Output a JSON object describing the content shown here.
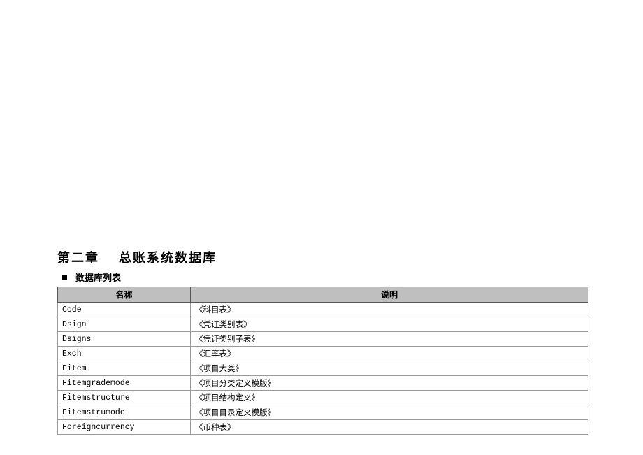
{
  "chapter": {
    "number": "第二章",
    "title": "总账系统数据库"
  },
  "subheading": "数据库列表",
  "table": {
    "headers": {
      "name": "名称",
      "desc": "说明"
    },
    "rows": [
      {
        "name": "Code",
        "desc": "《科目表》"
      },
      {
        "name": "Dsign",
        "desc": "《凭证类别表》"
      },
      {
        "name": "Dsigns",
        "desc": "《凭证类别子表》"
      },
      {
        "name": "Exch",
        "desc": "《汇率表》"
      },
      {
        "name": "Fitem",
        "desc": "《项目大类》"
      },
      {
        "name": "Fitemgrademode",
        "desc": "《项目分类定义模版》"
      },
      {
        "name": "Fitemstructure",
        "desc": "《项目结构定义》"
      },
      {
        "name": "Fitemstrumode",
        "desc": "《项目目录定义模版》"
      },
      {
        "name": "Foreigncurrency",
        "desc": "《币种表》"
      }
    ]
  }
}
